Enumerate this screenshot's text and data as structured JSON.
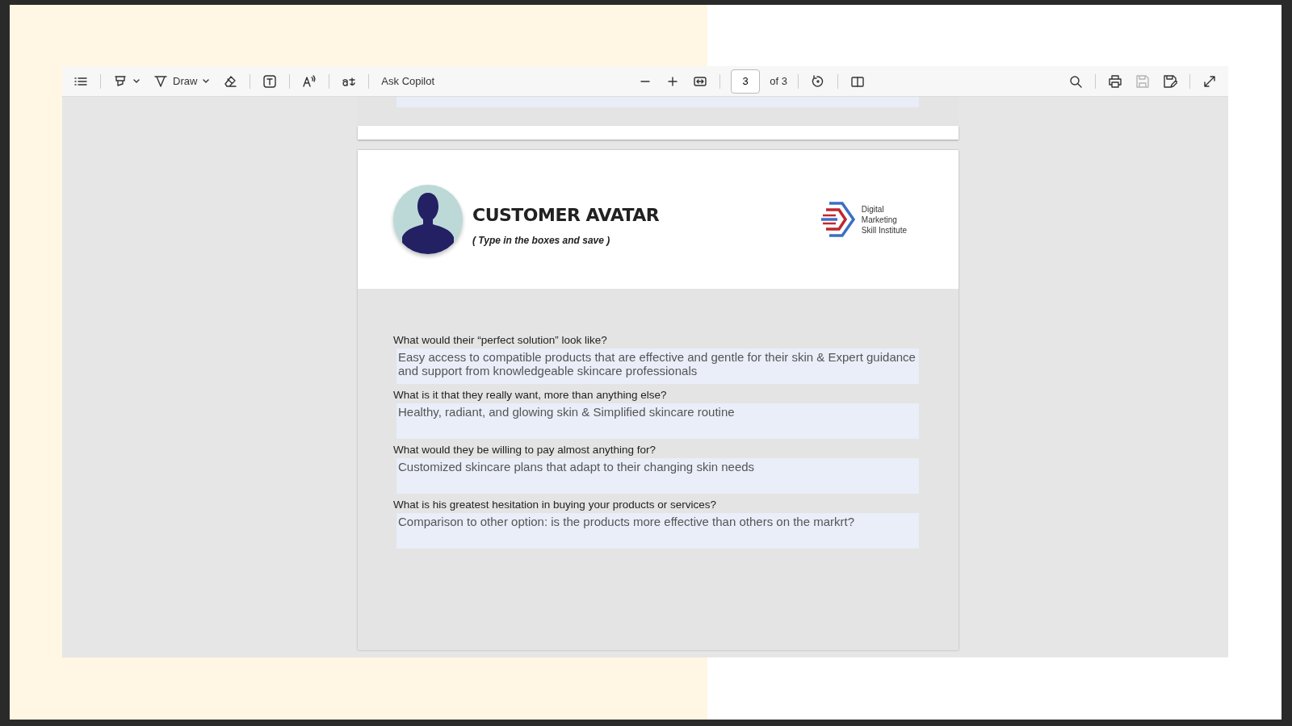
{
  "toolbar": {
    "left": [
      {
        "kind": "contents"
      },
      {
        "kind": "separator"
      },
      {
        "kind": "highlight",
        "caret": true
      },
      {
        "kind": "draw",
        "label": "Draw",
        "caret": true
      },
      {
        "kind": "eraser"
      },
      {
        "kind": "separator"
      },
      {
        "kind": "textbox"
      },
      {
        "kind": "separator"
      },
      {
        "kind": "read-aloud"
      },
      {
        "kind": "separator"
      },
      {
        "kind": "translate"
      },
      {
        "kind": "separator"
      },
      {
        "kind": "copilot",
        "label": "Ask Copilot"
      }
    ],
    "center": [
      {
        "kind": "zoom-out"
      },
      {
        "kind": "zoom-in"
      },
      {
        "kind": "fit-width"
      },
      {
        "kind": "separator"
      },
      {
        "kind": "page-field",
        "value": "3"
      },
      {
        "kind": "page-count",
        "label": "of 3"
      },
      {
        "kind": "separator"
      },
      {
        "kind": "rotate"
      },
      {
        "kind": "separator"
      },
      {
        "kind": "page-view"
      }
    ],
    "right": [
      {
        "kind": "search",
        "disabled": false
      },
      {
        "kind": "separator"
      },
      {
        "kind": "print",
        "disabled": false
      },
      {
        "kind": "save",
        "disabled": true
      },
      {
        "kind": "save-as",
        "disabled": false
      },
      {
        "kind": "separator"
      },
      {
        "kind": "fullscreen",
        "disabled": false
      }
    ]
  },
  "page": {
    "title": "CUSTOMER AVATAR",
    "subtitle": "( Type in the boxes and save )",
    "logo_lines": [
      "Digital",
      "Marketing",
      "Skill Institute"
    ],
    "questions": [
      {
        "question": "What would their “perfect solution” look like?",
        "answer": "Easy access to compatible products that are effective and gentle for their skin & Expert guidance and support from knowledgeable skincare professionals"
      },
      {
        "question": "What is it that they really want, more than anything else?",
        "answer": "Healthy, radiant, and glowing skin & Simplified skincare routine"
      },
      {
        "question": "What would they be willing to pay almost anything for?",
        "answer": "Customized skincare plans that adapt to their changing skin needs"
      },
      {
        "question": "What is his greatest hesitation in buying your products or services?",
        "answer": "Comparison to other option: is the products more effective than others on the markrt?"
      }
    ]
  }
}
